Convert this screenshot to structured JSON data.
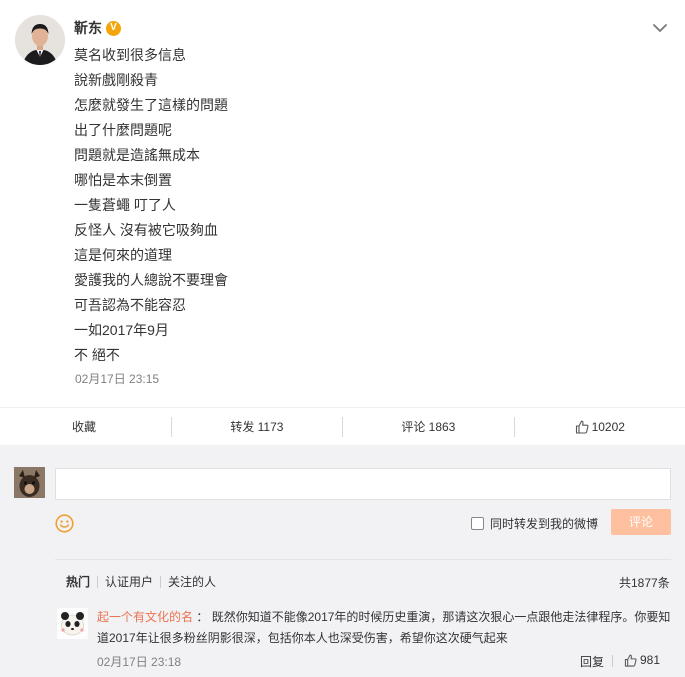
{
  "post": {
    "author": "靳东",
    "verified_badge": "V",
    "lines": [
      "莫名收到很多信息",
      "說新戲剛殺青",
      "怎麼就發生了這樣的問題",
      "出了什麼問題呢",
      "問題就是造謠無成本",
      "哪怕是本末倒置",
      "一隻蒼蠅 叮了人",
      "反怪人 沒有被它吸夠血",
      "這是何來的道理",
      "愛護我的人總說不要理會",
      "可吾認為不能容忍",
      "一如2017年9月",
      "不 絕不"
    ],
    "time": "02月17日 23:15",
    "menu_icon": "chevron-down-icon"
  },
  "actions": {
    "collect": "收藏",
    "forward": "转发 1173",
    "comment": "评论 1863",
    "like": "10202"
  },
  "composer": {
    "placeholder": "",
    "forward_label": "同时转发到我的微博",
    "submit_label": "评论"
  },
  "filters": {
    "hot": "热门",
    "verified": "认证用户",
    "following": "关注的人",
    "total": "共1877条"
  },
  "comments": [
    {
      "user": "起一个有文化的名",
      "colon": "：",
      "text": "既然你知道不能像2017年的时候历史重演，那请这次狠心一点跟他走法律程序。你要知道2017年让很多粉丝阴影很深，包括你本人也深受伤害，希望你这次硬气起来",
      "time": "02月17日 23:18",
      "reply": "回复",
      "likes": "981"
    }
  ],
  "colors": {
    "accent": "#eb7350",
    "button_disabled": "#ffc09f",
    "comment_bg": "#f2f2f5",
    "badge": "#f2a60b"
  }
}
